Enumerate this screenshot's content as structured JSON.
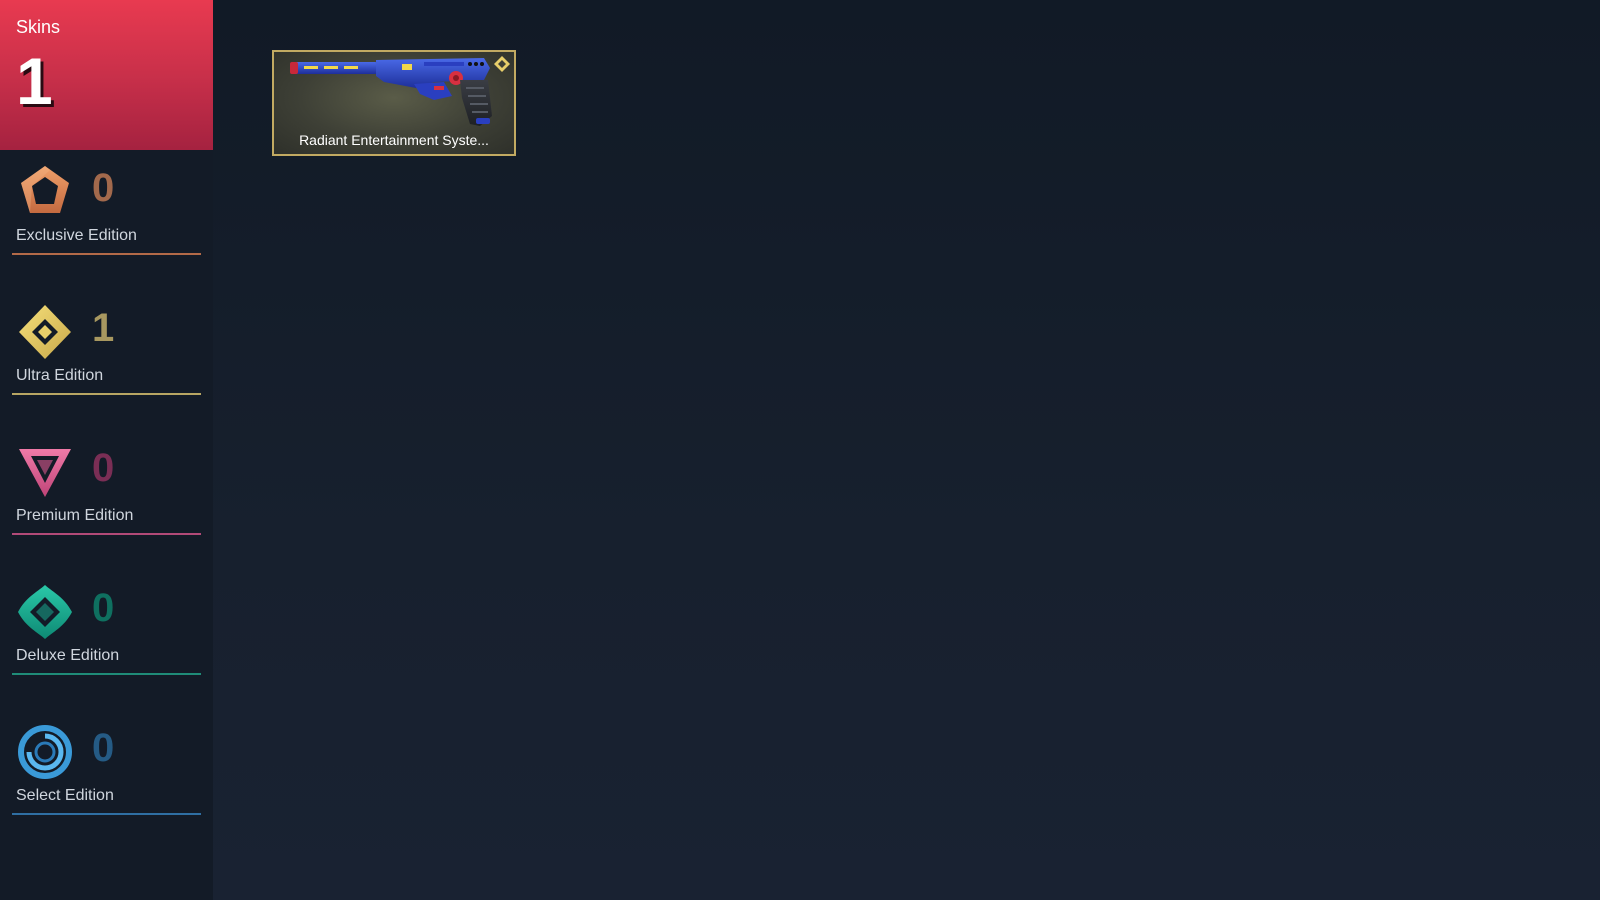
{
  "skins": {
    "title": "Skins",
    "count": "1"
  },
  "tiers": [
    {
      "label": "Exclusive Edition",
      "count": "0",
      "icon": "exclusive-edition-icon",
      "color": "#e08a5a"
    },
    {
      "label": "Ultra Edition",
      "count": "1",
      "icon": "ultra-edition-icon",
      "color": "#e8cf6a"
    },
    {
      "label": "Premium Edition",
      "count": "0",
      "icon": "premium-edition-icon",
      "color": "#d8588e"
    },
    {
      "label": "Deluxe Edition",
      "count": "0",
      "icon": "deluxe-edition-icon",
      "color": "#1aa88e"
    },
    {
      "label": "Select Edition",
      "count": "0",
      "icon": "select-edition-icon",
      "color": "#3a9ad8"
    }
  ],
  "items": [
    {
      "name": "Radiant Entertainment Syste...",
      "tier": "ultra-edition-icon",
      "border_color": "#c2aa62"
    }
  ]
}
